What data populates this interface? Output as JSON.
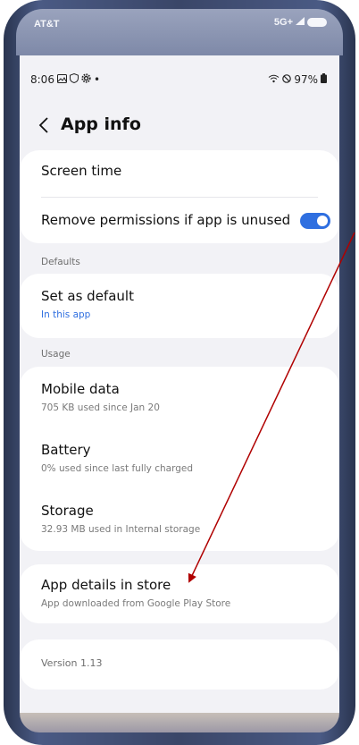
{
  "carrier": {
    "name": "AT&T",
    "network": "5G+"
  },
  "status_bar": {
    "time": "8:06",
    "battery": "97%"
  },
  "header": {
    "back_icon": "chevron-left-icon",
    "title": "App info"
  },
  "card_top": {
    "screen_time": "Screen time",
    "remove_permissions": "Remove permissions if app is unused",
    "remove_permissions_enabled": true
  },
  "defaults": {
    "label": "Defaults",
    "set_as_default": {
      "title": "Set as default",
      "subtitle": "In this app"
    }
  },
  "usage": {
    "label": "Usage",
    "mobile_data": {
      "title": "Mobile data",
      "subtitle": "705 KB used since Jan 20"
    },
    "battery": {
      "title": "Battery",
      "subtitle": "0% used since last fully charged"
    },
    "storage": {
      "title": "Storage",
      "subtitle": "32.93 MB used in Internal storage"
    }
  },
  "store": {
    "title": "App details in store",
    "subtitle": "App downloaded from Google Play Store"
  },
  "version": "Version 1.13",
  "colors": {
    "accent": "#2f6fe0",
    "annotation_arrow": "#b00000",
    "background": "#f2f2f6"
  }
}
